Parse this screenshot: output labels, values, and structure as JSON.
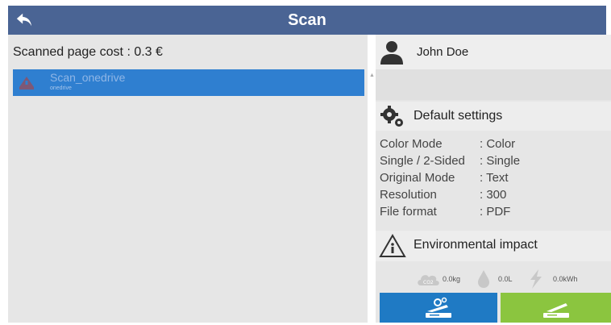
{
  "header": {
    "title": "Scan",
    "back_icon": "back-arrow-icon",
    "color": "#4a6494"
  },
  "left": {
    "cost_label": "Scanned page cost : 0.3 €",
    "items": [
      {
        "name": "Scan_onedrive",
        "sub": "onedrive",
        "icon": "cloud-icon",
        "selected": true
      }
    ],
    "selected_color": "#2f7fd0"
  },
  "user": {
    "name": "John Doe",
    "icon": "user-avatar-icon"
  },
  "default_settings": {
    "title": "Default settings",
    "icon": "gears-icon",
    "rows": [
      {
        "label": "Color Mode",
        "value": ": Color"
      },
      {
        "label": "Single / 2-Sided",
        "value": ": Single"
      },
      {
        "label": "Original Mode",
        "value": ": Text"
      },
      {
        "label": "Resolution",
        "value": ": 300"
      },
      {
        "label": "File format",
        "value": ": PDF"
      }
    ]
  },
  "environmental": {
    "title": "Environmental impact",
    "icon": "recycle-info-icon",
    "co2": "0.0kg",
    "water": "0.0L",
    "energy": "0.0kWh"
  },
  "actions": {
    "scan_settings_icon": "scanner-settings-icon",
    "scan_icon": "scanner-icon",
    "blue": "#1f7ac4",
    "green": "#8bc53f"
  }
}
